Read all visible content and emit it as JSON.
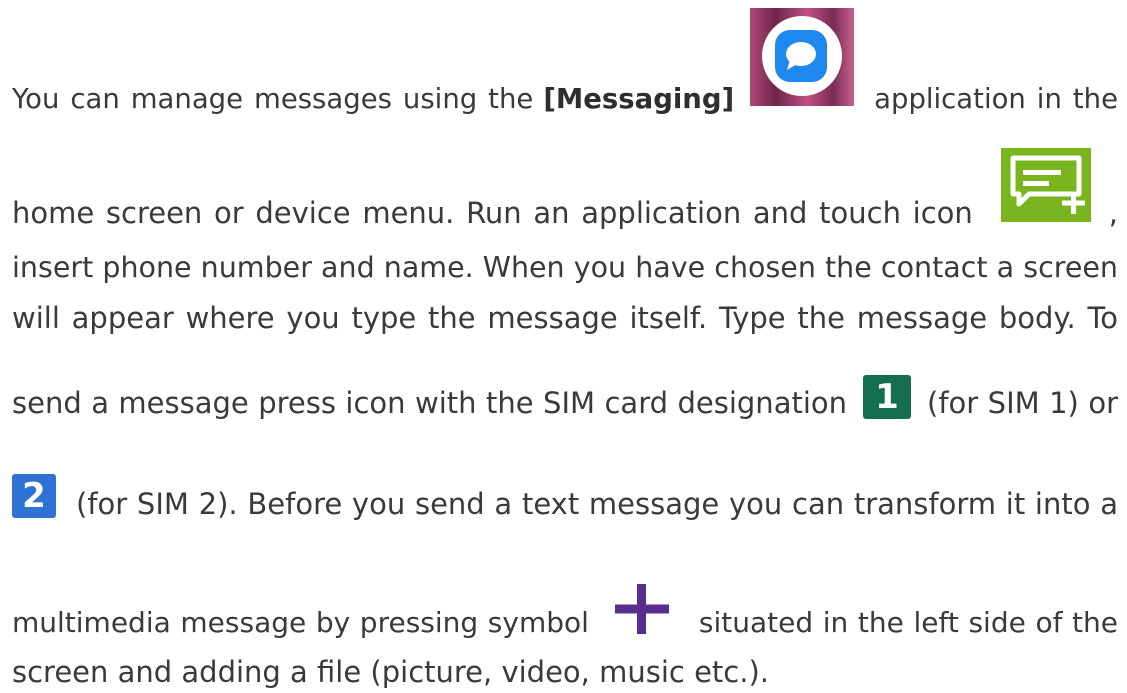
{
  "paragraph": {
    "l1_a": "You can manage messages using the",
    "l1_b": "[Messaging]",
    "l1_c": "application in the",
    "l2_a": "home screen or device menu. Run an application and touch icon",
    "l2_b": ",",
    "l3": "insert phone number and name. When you have chosen the contact a screen",
    "l4": "will appear where you type the message itself. Type the message body. To",
    "l5_a": "send a message press icon with the SIM card designation",
    "l5_b": "(for SIM 1) or",
    "l6_b": "(for SIM 2). Before you send a text message you can transform it into a",
    "l7_a": "multimedia message by pressing symbol",
    "l7_b": "situated in the left side of the",
    "l8": "screen and adding a file (picture, video, music etc.)."
  },
  "icons": {
    "messaging": "messaging-app-icon",
    "new_message": "new-message-icon",
    "sim1": "1",
    "sim2": "2",
    "attach": "plus-icon"
  },
  "colors": {
    "text": "#3a3a3a",
    "new_message_bg": "#7ab51f",
    "sim1_bg": "#146e4f",
    "sim2_bg": "#2f72d6",
    "plus": "#5a2d91"
  }
}
